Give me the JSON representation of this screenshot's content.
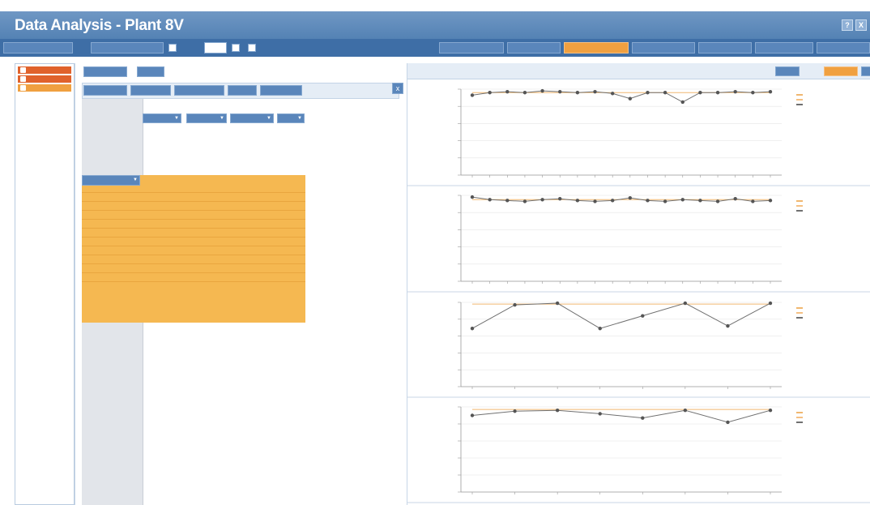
{
  "window": {
    "title": "Data Analysis - Plant 8V",
    "buttons": [
      "?",
      "X"
    ]
  },
  "toolbar": {
    "left_buttons": [
      "",
      ""
    ],
    "sel1_value": "",
    "sel2_value": ""
  },
  "tabs": [
    "",
    "",
    "",
    "",
    "",
    "",
    ""
  ],
  "active_tab_index": 2,
  "colors": {
    "title_blue": "#5a86bb",
    "toolbar_blue": "#3e6ea6",
    "active_orange": "#f0a040",
    "grid_orange": "#f5b851",
    "alert_red": "#d9421f",
    "series_gray": "#707070",
    "limit_orange": "#f0b770"
  },
  "nav_items": [
    {
      "label": "",
      "color": "red"
    },
    {
      "label": "",
      "color": "red"
    },
    {
      "label": "",
      "color": "orange"
    }
  ],
  "left_panel": {
    "top_buttons": [
      "",
      ""
    ],
    "sub_tabs": [
      "",
      "",
      "",
      "",
      ""
    ],
    "close_label": "x",
    "dropdowns": [
      "",
      "",
      "",
      ""
    ],
    "checkboxes": [
      "",
      "",
      ""
    ],
    "header_labels": [
      "",
      "",
      ""
    ],
    "main_dropdown": "",
    "columns": [
      "",
      "",
      "",
      "",
      "",
      ""
    ],
    "rows": [
      {
        "label": "",
        "cells": [
          "",
          "",
          "",
          "",
          "",
          ""
        ],
        "red": [
          0,
          0,
          0,
          0,
          0,
          0
        ]
      },
      {
        "label": "",
        "cells": [
          "",
          "",
          "",
          "",
          "",
          ""
        ],
        "red": [
          0,
          0,
          0,
          0,
          0,
          0
        ]
      },
      {
        "label": "",
        "cells": [
          "",
          "",
          "",
          "",
          "",
          ""
        ],
        "red": [
          0,
          0,
          0,
          0,
          0,
          0
        ]
      },
      {
        "label": "",
        "cells": [
          "",
          "",
          "",
          "",
          "",
          ""
        ],
        "red": [
          0,
          0,
          0,
          0,
          0,
          0
        ]
      },
      {
        "label": "",
        "cells": [
          "",
          "",
          "",
          "",
          "",
          ""
        ],
        "red": [
          0,
          0,
          0,
          0,
          0,
          0
        ]
      },
      {
        "label": "",
        "cells": [
          "",
          "",
          "",
          "",
          "",
          ""
        ],
        "red": [
          0,
          0,
          0,
          0,
          0,
          0
        ]
      },
      {
        "label": "",
        "cells": [
          "",
          "",
          "",
          "",
          "",
          ""
        ],
        "red": [
          0,
          0,
          0,
          0,
          0,
          0
        ]
      },
      {
        "label": "",
        "cells": [
          "",
          "",
          "",
          "",
          "",
          ""
        ],
        "red": [
          0,
          0,
          0,
          0,
          0,
          0
        ]
      },
      {
        "label": "",
        "cells": [
          "",
          "",
          "",
          "",
          "",
          ""
        ],
        "red": [
          0,
          0,
          0,
          0,
          0,
          0
        ]
      },
      {
        "label": "",
        "cells": [
          "",
          "",
          "",
          "",
          "",
          ""
        ],
        "red": [
          0,
          0,
          0,
          0,
          0,
          0
        ]
      },
      {
        "label": "",
        "cells": [
          "",
          "",
          "",
          "",
          "",
          ""
        ],
        "red": [
          0,
          0,
          0,
          0,
          0,
          0
        ]
      }
    ]
  },
  "right_panel": {
    "buttons": [
      "",
      ""
    ]
  },
  "chart_data": [
    {
      "type": "line",
      "ylim": [
        0,
        100
      ],
      "series": [
        {
          "values": [
            93,
            96,
            97,
            96,
            98,
            97,
            96,
            97,
            95,
            89,
            96,
            96,
            85,
            96,
            96,
            97,
            96,
            97
          ]
        },
        {
          "values": [
            96,
            96,
            96,
            96,
            96,
            96,
            96,
            96,
            96,
            96,
            96,
            96,
            96,
            96,
            96,
            96,
            96,
            96
          ]
        }
      ],
      "x_tick_count": 18,
      "grid": true,
      "legend_position": "right"
    },
    {
      "type": "line",
      "ylim": [
        0,
        100
      ],
      "series": [
        {
          "values": [
            98,
            95,
            94,
            93,
            95,
            96,
            94,
            93,
            94,
            97,
            94,
            93,
            95,
            94,
            93,
            96,
            93,
            94
          ]
        },
        {
          "values": [
            95,
            95,
            95,
            95,
            95,
            95,
            95,
            95,
            95,
            95,
            95,
            95,
            95,
            95,
            95,
            95,
            95,
            95
          ]
        }
      ],
      "x_tick_count": 18,
      "grid": true,
      "legend_position": "right"
    },
    {
      "type": "line",
      "ylim": [
        0,
        100
      ],
      "series": [
        {
          "values": [
            69,
            97,
            99,
            69,
            84,
            99,
            72,
            99
          ]
        },
        {
          "values": [
            98,
            98,
            98,
            98,
            98,
            98,
            98,
            98
          ]
        }
      ],
      "x_tick_count": 8,
      "grid": true,
      "legend_position": "right"
    },
    {
      "type": "line",
      "ylim": [
        0,
        100
      ],
      "series": [
        {
          "values": [
            90,
            95,
            96,
            92,
            87,
            96,
            82,
            96
          ]
        },
        {
          "values": [
            97,
            97,
            97,
            97,
            97,
            97,
            97,
            97
          ]
        }
      ],
      "x_tick_count": 8,
      "grid": true,
      "legend_position": "right"
    }
  ]
}
